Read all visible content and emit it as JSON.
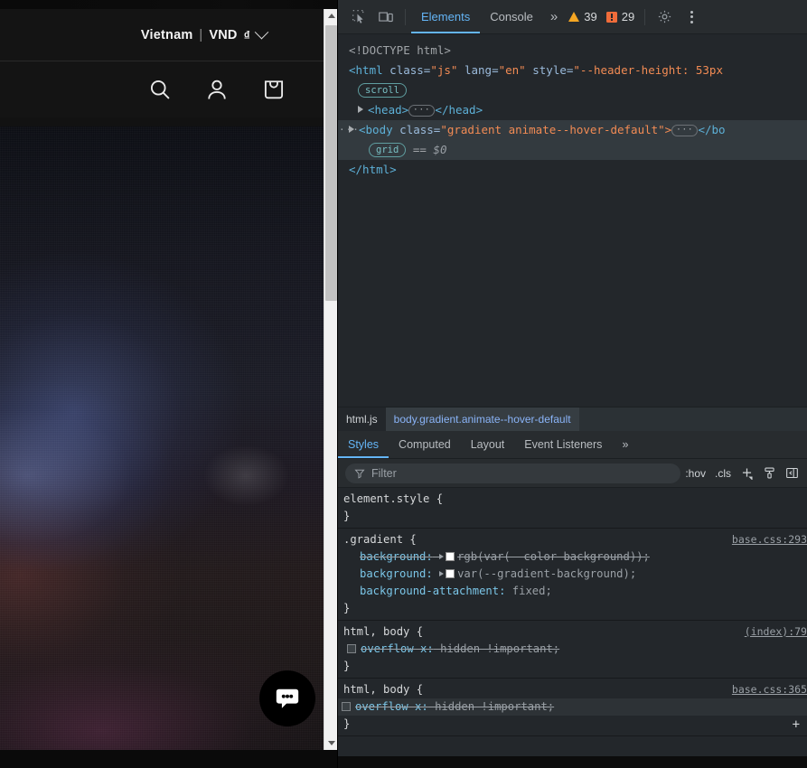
{
  "page": {
    "locale": {
      "country": "Vietnam",
      "separator": "|",
      "currency": "VND",
      "symbol": "₫"
    },
    "header_icons": [
      "search-icon",
      "account-icon",
      "bag-icon"
    ],
    "chat_widget_icon": "chat-bubble-icon"
  },
  "devtools": {
    "toolbar": {
      "inspect_icon": "inspect-element-icon",
      "device_icon": "device-toolbar-icon",
      "tabs": [
        {
          "label": "Elements",
          "active": true
        },
        {
          "label": "Console",
          "active": false
        }
      ],
      "more_tabs": "»",
      "warnings_count": "39",
      "errors_count": "29",
      "settings_icon": "gear-icon",
      "menu_icon": "kebab-menu-icon"
    },
    "dom": {
      "doctype": "<!DOCTYPE html>",
      "html_open_tag": "<html",
      "html_attr_class_name": "class=",
      "html_attr_class_value": "\"js\"",
      "html_attr_lang_name": "lang=",
      "html_attr_lang_value": "\"en\"",
      "html_attr_style_name": "style=",
      "html_attr_style_value": "\"--header-height: 53px",
      "scroll_badge": "scroll",
      "head_open": "<head>",
      "head_close": "</head>",
      "body_open": "<body",
      "body_class_name": "class=",
      "body_class_value": "\"gradient animate--hover-default\">",
      "body_close": "</bo",
      "grid_badge": "grid",
      "equals": "==",
      "dollar_zero": "$0",
      "html_close": "</html>"
    },
    "breadcrumbs": [
      {
        "label": "html.js",
        "active": false
      },
      {
        "label": "body.gradient.animate--hover-default",
        "active": true
      }
    ],
    "sidebar_tabs": [
      {
        "label": "Styles",
        "active": true
      },
      {
        "label": "Computed",
        "active": false
      },
      {
        "label": "Layout",
        "active": false
      },
      {
        "label": "Event Listeners",
        "active": false
      },
      {
        "label": "»",
        "active": false
      }
    ],
    "filter": {
      "icon": "filter-icon",
      "placeholder": "Filter",
      "value": "",
      "hov_label": ":hov",
      "cls_label": ".cls",
      "new_rule_icon": "add-style-rule-icon",
      "class_icon": "element-classes-icon",
      "sidebar_toggle_icon": "toggle-sidebar-icon"
    },
    "styles": {
      "rules": [
        {
          "selector": "element.style {",
          "origin": "",
          "close": "}",
          "declarations": []
        },
        {
          "selector": ".gradient {",
          "origin": "base.css:293",
          "close": "}",
          "declarations": [
            {
              "name": "background:",
              "value": "rgb(var(--color-background));",
              "strike": true,
              "swatch": true,
              "expand": true,
              "checkbox": false
            },
            {
              "name": "background:",
              "value": "var(--gradient-background);",
              "strike": false,
              "swatch": true,
              "expand": true,
              "checkbox": false
            },
            {
              "name": "background-attachment:",
              "value": "fixed;",
              "strike": false,
              "swatch": false,
              "expand": false,
              "checkbox": false
            }
          ]
        },
        {
          "selector": "html, body {",
          "origin": "(index):79",
          "close": "}",
          "declarations": [
            {
              "name": "overflow-x:",
              "value": "hidden !important;",
              "strike": true,
              "swatch": false,
              "expand": false,
              "checkbox": true
            }
          ]
        },
        {
          "selector": "html, body {",
          "origin": "base.css:365",
          "close": "}",
          "declarations": [
            {
              "name": "overflow-x:",
              "value": "hidden !important;",
              "strike": true,
              "swatch": false,
              "expand": false,
              "checkbox": true,
              "highlight": true
            }
          ]
        }
      ],
      "add_rule_label": "+"
    }
  },
  "colors": {
    "accent_blue": "#64b5f6",
    "warning_orange": "#f5a623",
    "error_orange": "#f06c3a",
    "devtools_bg": "#23272b",
    "toolbar_bg": "#282c2f",
    "selected_row": "#333a3f"
  }
}
